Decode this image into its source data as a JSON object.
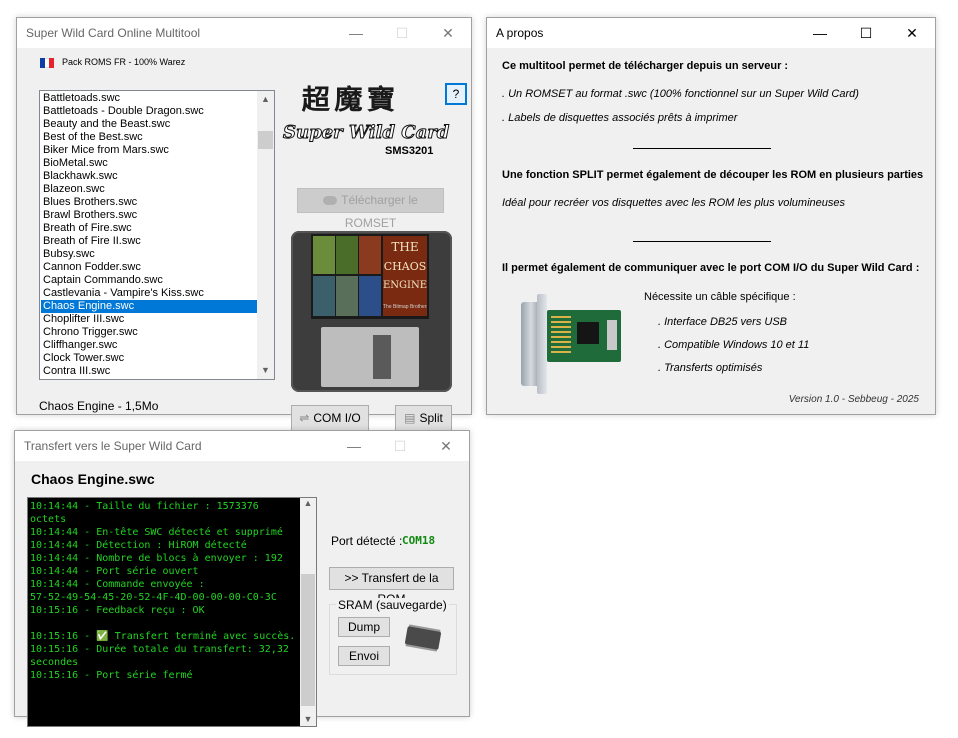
{
  "main_window": {
    "title": "Super Wild Card Online Multitool",
    "pack_label": "Pack ROMS FR - 100% Warez",
    "logo_kanji": "超魔寶",
    "logo_text": "Super Wild Card",
    "model": "SMS3201",
    "help_button": "?",
    "download_button": "Télécharger le ROMSET",
    "com_button": "COM I/O",
    "split_button": "Split",
    "status": "Chaos Engine - 1,5Mo",
    "game_art_title": [
      "THE",
      "CHAOS",
      "ENGINE"
    ],
    "game_art_caption": "The Bitmap Brothers",
    "rom_list": [
      "Battletoads.swc",
      "Battletoads - Double Dragon.swc",
      "Beauty and the Beast.swc",
      "Best of the Best.swc",
      "Biker Mice from Mars.swc",
      "BioMetal.swc",
      "Blackhawk.swc",
      "Blazeon.swc",
      "Blues Brothers.swc",
      "Brawl Brothers.swc",
      "Breath of Fire.swc",
      "Breath of Fire II.swc",
      "Bubsy.swc",
      "Cannon Fodder.swc",
      "Captain Commando.swc",
      "Castlevania - Vampire's Kiss.swc",
      "Chaos Engine.swc",
      "Choplifter III.swc",
      "Chrono Trigger.swc",
      "Cliffhanger.swc",
      "Clock Tower.swc",
      "Contra III.swc"
    ],
    "selected_index": 16
  },
  "about_window": {
    "title": "A propos",
    "heading1": "Ce multitool permet de télécharger depuis un serveur :",
    "line1": ". Un ROMSET au format .swc (100% fonctionnel sur un Super Wild Card)",
    "line2": ". Labels de disquettes associés prêts à imprimer",
    "heading2": "Une fonction SPLIT permet également de découper les ROM en plusieurs parties",
    "line3": "Idéal pour recréer vos disquettes avec les ROM les plus volumineuses",
    "heading3": "Il permet également de communiquer avec le port COM I/O du Super Wild Card :",
    "cable_title": "Nécessite un câble spécifique :",
    "cable_items": [
      ". Interface DB25 vers USB",
      ". Compatible Windows 10 et 11",
      ". Transferts optimisés"
    ],
    "version": "Version 1.0 - Sebbeug - 2025"
  },
  "transfer_window": {
    "title": "Transfert vers le Super Wild Card",
    "file_name": "Chaos Engine.swc",
    "port_label": "Port détecté :",
    "port_value": "COM18",
    "transfer_button": ">> Transfert de la ROM",
    "sram_group": "SRAM (sauvegarde)",
    "dump_button": "Dump",
    "send_button": "Envoi",
    "log_lines": [
      "10:14:44 - Taille du fichier : 1573376",
      "octets",
      "10:14:44 - En-tête SWC détecté et supprimé",
      "10:14:44 - Détection : HiROM détecté",
      "10:14:44 - Nombre de blocs à envoyer : 192",
      "10:14:44 - Port série ouvert",
      "10:14:44 - Commande envoyée :",
      "57-52-49-54-45-20-52-4F-4D-00-00-00-C0-3C",
      "10:15:16 - Feedback reçu : OK",
      "",
      "10:15:16 - ✅ Transfert terminé avec succès.",
      "10:15:16 - Durée totale du transfert: 32,32",
      "secondes",
      "10:15:16 - Port série fermé"
    ]
  },
  "colors": {
    "selection": "#0078d7",
    "console_text": "#22d322",
    "port_value": "#108a10"
  }
}
